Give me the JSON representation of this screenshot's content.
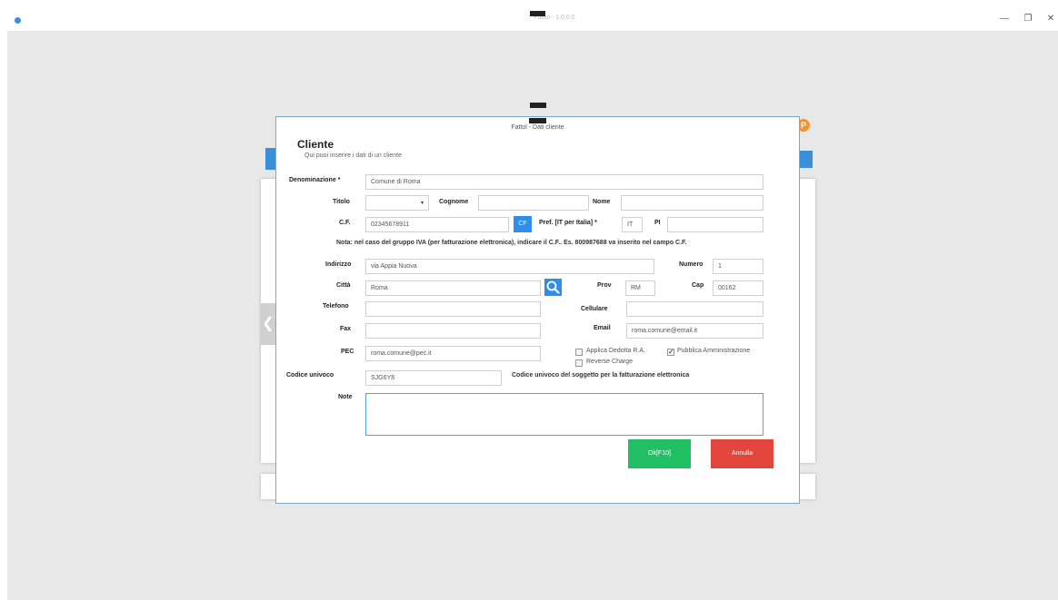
{
  "window": {
    "title": "Fattol - 1.0.0.0",
    "minimize": "—",
    "restore": "❐",
    "close": "✕"
  },
  "background": {
    "logo_glyph": "P",
    "nav_arrow": "❮"
  },
  "dialog": {
    "title": "Fattol - Dati cliente",
    "heading": "Cliente",
    "subheading": "Qui puoi inserire i dati di un cliente"
  },
  "form": {
    "denominazione": {
      "label": "Denominazione *",
      "value": "Comune di Roma"
    },
    "titolo": {
      "label": "Titolo",
      "value": ""
    },
    "cognome": {
      "label": "Cognome",
      "value": ""
    },
    "nome": {
      "label": "Nome",
      "value": ""
    },
    "cf": {
      "label": "C.F.",
      "value": "02345678911",
      "button": "CF"
    },
    "pref": {
      "label": "Pref. [IT per Italia] *",
      "value": "IT"
    },
    "pi": {
      "label": "PI",
      "value": ""
    },
    "note_iva": "Nota: nel caso del gruppo IVA (per fatturazione elettronica), indicare il C.F.. Es. 800987688 va inserito nel campo C.F.",
    "indirizzo": {
      "label": "Indirizzo",
      "value": "via Appia Nuova"
    },
    "numero": {
      "label": "Numero",
      "value": "1"
    },
    "citta": {
      "label": "Città",
      "value": "Roma"
    },
    "prov": {
      "label": "Prov",
      "value": "RM"
    },
    "cap": {
      "label": "Cap",
      "value": "00162"
    },
    "telefono": {
      "label": "Telefono",
      "value": ""
    },
    "cellulare": {
      "label": "Cellulare",
      "value": ""
    },
    "fax": {
      "label": "Fax",
      "value": ""
    },
    "email": {
      "label": "Email",
      "value": "roma.comune@email.it"
    },
    "pec": {
      "label": "PEC",
      "value": "roma.comune@pec.it"
    },
    "applica_dedotta": {
      "label": "Applica Dedotta R.A.",
      "checked": false
    },
    "pubblica_amministrazione": {
      "label": "Pubblica Amministrazione",
      "checked": true,
      "mark": "✓"
    },
    "reverse_charge": {
      "label": "Reverse Charge",
      "checked": false
    },
    "codice_univoco": {
      "label": "Codice univoco",
      "value": "SJG6Y8",
      "hint": "Codice univoco del soggetto per la fatturazione elettronica"
    },
    "note": {
      "label": "Note",
      "value": ""
    }
  },
  "buttons": {
    "ok": "Ok[F10]",
    "annulla": "Annulla"
  },
  "colors": {
    "ok": "#21c065",
    "annulla": "#e2453c",
    "accent": "#2e8ee8"
  }
}
